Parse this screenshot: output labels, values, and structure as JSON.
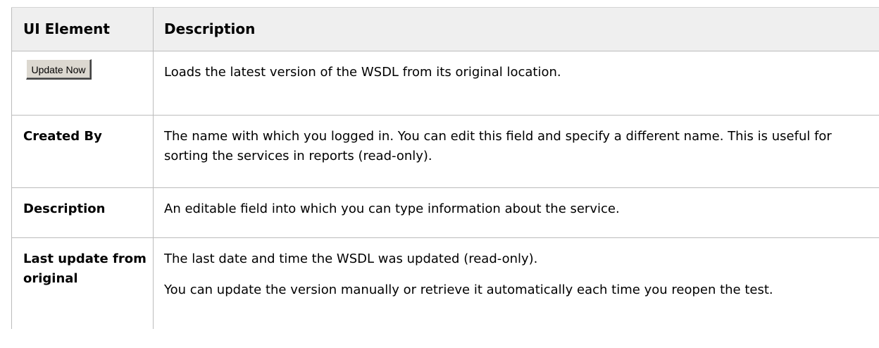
{
  "table": {
    "headers": {
      "ui_element": "UI Element",
      "description": "Description"
    },
    "rows": [
      {
        "button_label": "Update Now",
        "description": [
          "Loads the latest version of the WSDL from its original location."
        ]
      },
      {
        "element": "Created By",
        "description": [
          "The name with which you logged in. You can edit this field and specify a different name. This is useful for sorting the services in reports (read-only)."
        ]
      },
      {
        "element": "Description",
        "description": [
          "An editable field into which you can type information about the service."
        ]
      },
      {
        "element": "Last update from original",
        "description": [
          "The last date and time the WSDL was updated (read-only).",
          "You can update the version manually or retrieve it automatically each time you reopen the test."
        ]
      }
    ]
  }
}
